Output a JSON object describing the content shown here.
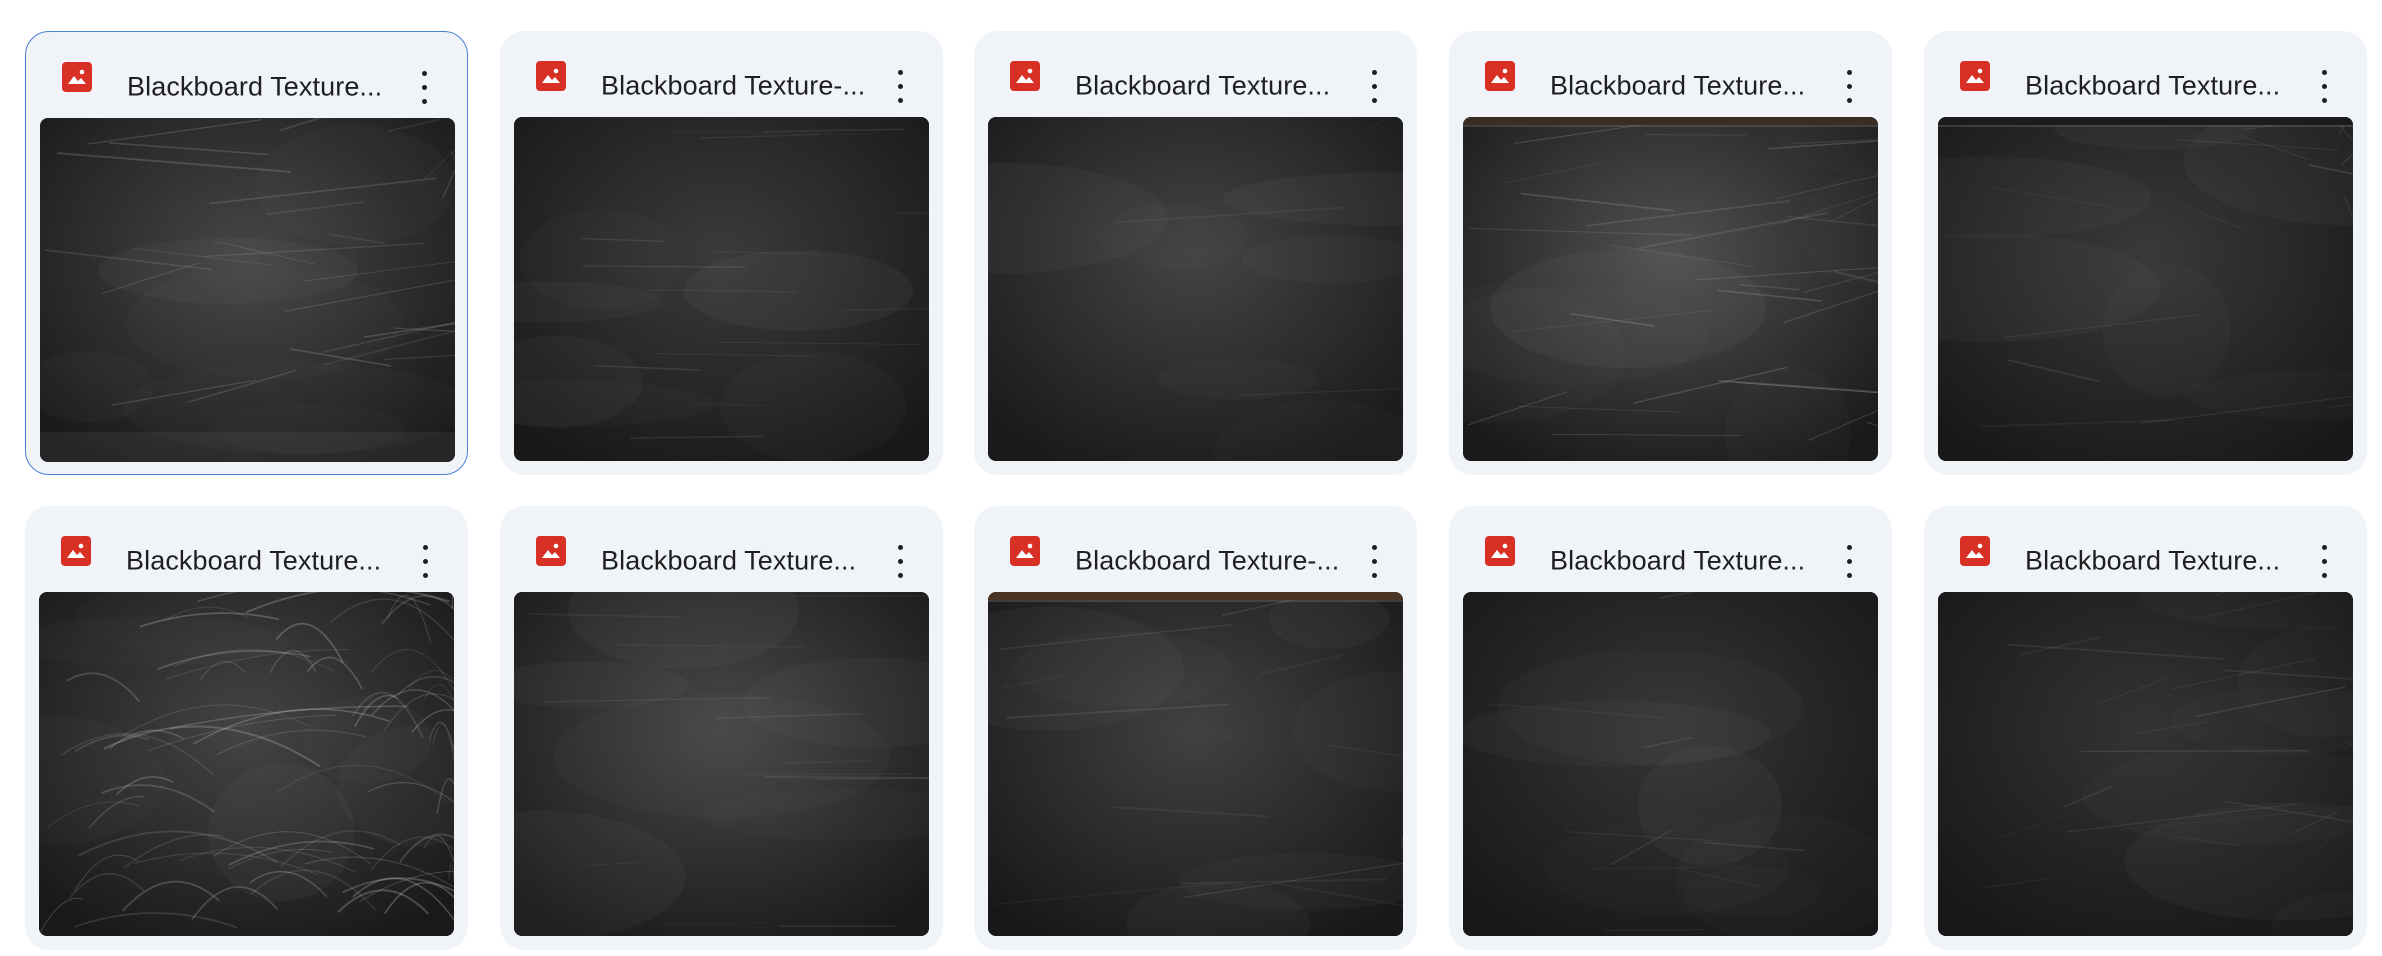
{
  "colors": {
    "card_background": "#f0f4f9",
    "selected_border": "#4a7fd6",
    "image_icon": "#d93025",
    "text": "#1f1f1f"
  },
  "files": [
    {
      "name": "Blackboard Texture...",
      "icon": "image-file-icon",
      "selected": true,
      "texture": "streaky-light-edges"
    },
    {
      "name": "Blackboard Texture-...",
      "icon": "image-file-icon",
      "selected": false,
      "texture": "horizontal-wood-grain"
    },
    {
      "name": "Blackboard Texture...",
      "icon": "image-file-icon",
      "selected": false,
      "texture": "smooth-smudged"
    },
    {
      "name": "Blackboard Texture...",
      "icon": "image-file-icon",
      "selected": false,
      "texture": "light-streaks-top-frame"
    },
    {
      "name": "Blackboard Texture...",
      "icon": "image-file-icon",
      "selected": false,
      "texture": "dark-top-frame"
    },
    {
      "name": "Blackboard Texture...",
      "icon": "image-file-icon",
      "selected": false,
      "texture": "heavy-chalk-scribbles"
    },
    {
      "name": "Blackboard Texture...",
      "icon": "image-file-icon",
      "selected": false,
      "texture": "soft-gray-lines"
    },
    {
      "name": "Blackboard Texture-...",
      "icon": "image-file-icon",
      "selected": false,
      "texture": "wood-frame-top"
    },
    {
      "name": "Blackboard Texture...",
      "icon": "image-file-icon",
      "selected": false,
      "texture": "dark-smudged"
    },
    {
      "name": "Blackboard Texture...",
      "icon": "image-file-icon",
      "selected": false,
      "texture": "dark-scratched"
    }
  ]
}
